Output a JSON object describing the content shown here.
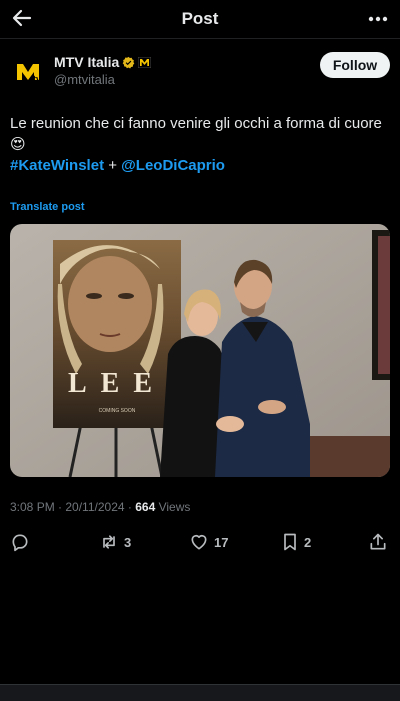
{
  "header": {
    "title": "Post",
    "back_icon": "arrow-left-icon",
    "more_icon": "more-horizontal-icon"
  },
  "author": {
    "name": "MTV Italia",
    "handle": "@mtvitalia",
    "follow_label": "Follow",
    "verified_color": "#e2b719",
    "logo_text": "M"
  },
  "tweet": {
    "text": "Le reunion che ci fanno venire gli occhi a forma di cuore 😍",
    "hashtag": "#KateWinslet",
    "connector": "+",
    "mention": "@LeoDiCaprio"
  },
  "translate_label": "Translate post",
  "media": {
    "poster_title": "LEE",
    "poster_tagline": "COMING SOON"
  },
  "meta": {
    "time": "3:08 PM",
    "date": "20/11/2024",
    "views": "664",
    "views_label": "Views"
  },
  "actions": {
    "reposts": "3",
    "likes": "17",
    "bookmarks": "2"
  },
  "colors": {
    "accent": "#1d9bf0",
    "background": "#000000"
  }
}
